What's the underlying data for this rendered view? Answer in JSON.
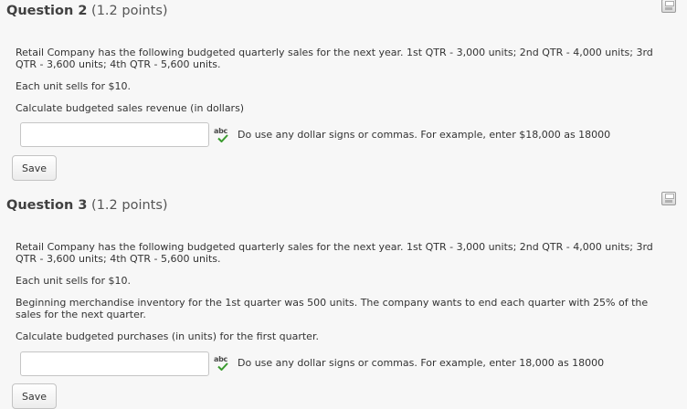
{
  "questions": [
    {
      "title": "Question 2",
      "points": "(1.2 points)",
      "paragraphs": [
        "Retail Company has the following budgeted quarterly sales for the next year.  1st QTR - 3,000  units; 2nd QTR - 4,000 units; 3rd QTR - 3,600 units; 4th QTR - 5,600 units.",
        "Each unit sells for $10.",
        "Calculate budgeted sales revenue (in dollars)"
      ],
      "answer_value": "",
      "spell_icon_text": "abc",
      "hint": "Do use any dollar signs or commas.  For example, enter $18,000 as 18000",
      "save_label": "Save"
    },
    {
      "title": "Question 3",
      "points": "(1.2 points)",
      "paragraphs": [
        "Retail Company has the following budgeted quarterly sales for the next year.  1st QTR - 3,000  units; 2nd QTR - 4,000 units; 3rd QTR - 3,600 units; 4th QTR - 5,600 units.",
        "Each unit sells for $10.",
        "Beginning merchandise inventory for the 1st quarter was 500 units.  The company wants to end each quarter with 25% of the sales for the next quarter.",
        "Calculate budgeted purchases (in units) for the first quarter."
      ],
      "answer_value": "",
      "spell_icon_text": "abc",
      "hint": "Do use any dollar signs or commas.  For example, enter 18,000 as 18000",
      "save_label": "Save"
    }
  ],
  "colors": {
    "background": "#f7f7f7",
    "text": "#333333",
    "check_green": "#3a9a2e"
  }
}
